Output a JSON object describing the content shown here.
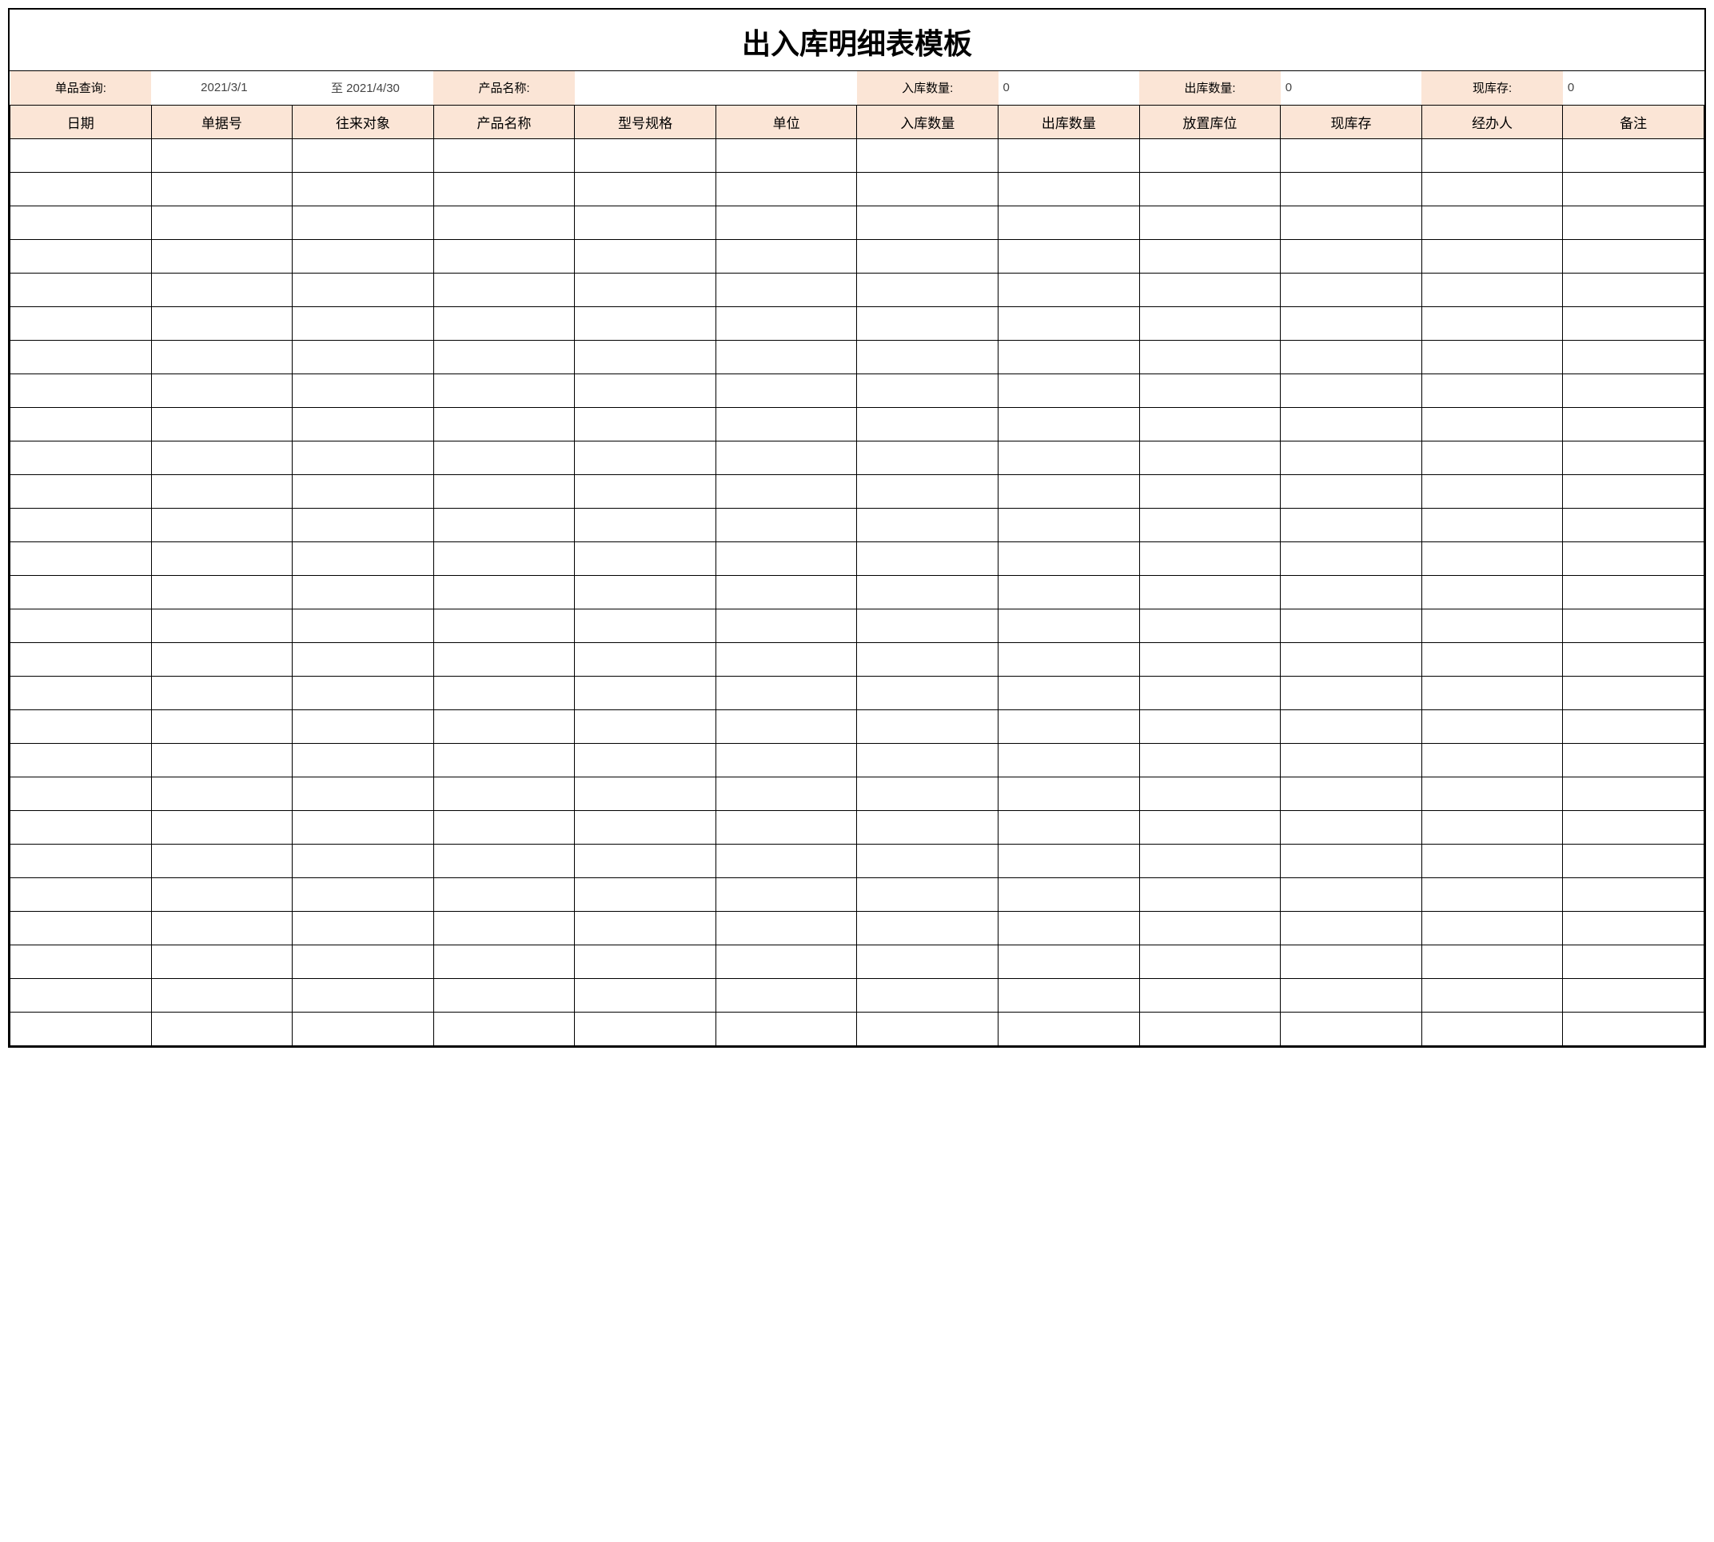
{
  "title": "出入库明细表模板",
  "filter": {
    "query_label": "单品查询:",
    "date_from": "2021/3/1",
    "date_to_prefix": "至",
    "date_to": "2021/4/30",
    "product_name_label": "产品名称:",
    "product_name_value": "",
    "in_qty_label": "入库数量:",
    "in_qty_value": "0",
    "out_qty_label": "出库数量:",
    "out_qty_value": "0",
    "stock_label": "现库存:",
    "stock_value": "0"
  },
  "columns": [
    "日期",
    "单据号",
    "往来对象",
    "产品名称",
    "型号规格",
    "单位",
    "入库数量",
    "出库数量",
    "放置库位",
    "现库存",
    "经办人",
    "备注"
  ],
  "empty_row_count": 27
}
